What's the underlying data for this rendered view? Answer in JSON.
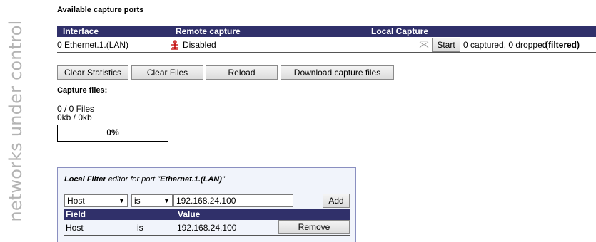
{
  "brand": "networks under control",
  "section_title": "Available capture ports",
  "ports": {
    "headers": [
      "Interface",
      "Remote capture",
      "Local Capture"
    ],
    "row": {
      "interface": "0 Ethernet.1.(LAN)",
      "remote_status": "Disabled",
      "start_label": "Start",
      "stats": "0 captured, 0 dropped",
      "filter_state": "(filtered)"
    }
  },
  "toolbar": {
    "clear_statistics": "Clear Statistics",
    "clear_files": "Clear Files",
    "reload": "Reload",
    "download": "Download capture files"
  },
  "files": {
    "title": "Capture files:",
    "count": "0 / 0 Files",
    "size": "0kb / 0kb",
    "progress_text": "0%",
    "progress_value": 0
  },
  "filter": {
    "title_prefix": "Local Filter",
    "title_middle": " editor for port \"",
    "port": "Ethernet.1.(LAN)",
    "title_suffix": "\"",
    "field_select": "Host",
    "operator_select": "is",
    "value_input": "192.168.24.100",
    "add_label": "Add",
    "headers": [
      "Field",
      "Value"
    ],
    "rows": [
      {
        "field": "Host",
        "op": "is",
        "value": "192.168.24.100",
        "action": "Remove"
      }
    ]
  },
  "colors": {
    "header_bg": "#30306a",
    "brand_text": "#b3b3b3",
    "filter_bg": "#f1f4fb"
  },
  "icons": {
    "remote_disabled": "disabled-antenna-icon",
    "local_capture": "capture-envelope-icon"
  }
}
